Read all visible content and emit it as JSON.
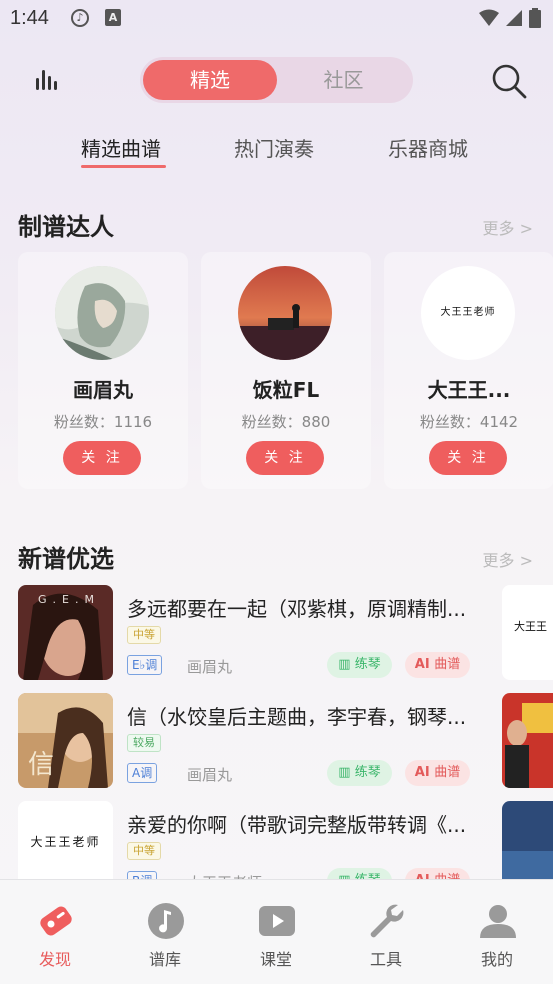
{
  "status_bar": {
    "time": "1:44",
    "icon_a": "A"
  },
  "header": {
    "segments": [
      "精选",
      "社区"
    ],
    "active_segment": "精选"
  },
  "sub_tabs": [
    "精选曲谱",
    "热门演奏",
    "乐器商城"
  ],
  "experts": {
    "title": "制谱达人",
    "more": "更多 >",
    "follow_label": "关 注",
    "cards": [
      {
        "name": "画眉丸",
        "fans": "粉丝数：1116"
      },
      {
        "name": "饭粒FL",
        "fans": "粉丝数：880"
      },
      {
        "name": "大王王...",
        "fans": "粉丝数：4142",
        "avatar_text": "大王王老师"
      }
    ]
  },
  "new_scores": {
    "title": "新谱优选",
    "more": "更多 >",
    "practice_label": "练琴",
    "score_label": "曲谱",
    "items": [
      {
        "title": "多远都要在一起（邓紫棋，原调精制...",
        "level": "中等",
        "key": "E♭调",
        "author": "画眉丸",
        "cover_text": "G.E.M"
      },
      {
        "title": "信（水饺皇后主题曲，李宇春，钢琴...",
        "level": "较易",
        "key": "A调",
        "author": "画眉丸",
        "cover_text": "信"
      },
      {
        "title": "亲爱的你啊（带歌词完整版带转调《...",
        "level": "中等",
        "key": "B调",
        "author": "大王王老师",
        "cover_text": "大王王老师"
      }
    ],
    "side_cover_text": "大王王"
  },
  "bottom_nav": [
    {
      "label": "发现",
      "icon": "discover-icon",
      "active": true
    },
    {
      "label": "谱库",
      "icon": "music-note-icon",
      "active": false
    },
    {
      "label": "课堂",
      "icon": "video-play-icon",
      "active": false
    },
    {
      "label": "工具",
      "icon": "wrench-icon",
      "active": false
    },
    {
      "label": "我的",
      "icon": "profile-icon",
      "active": false
    }
  ],
  "colors": {
    "accent": "#ef6a6a",
    "green": "#3ab56a",
    "blue": "#4c7fd6"
  }
}
